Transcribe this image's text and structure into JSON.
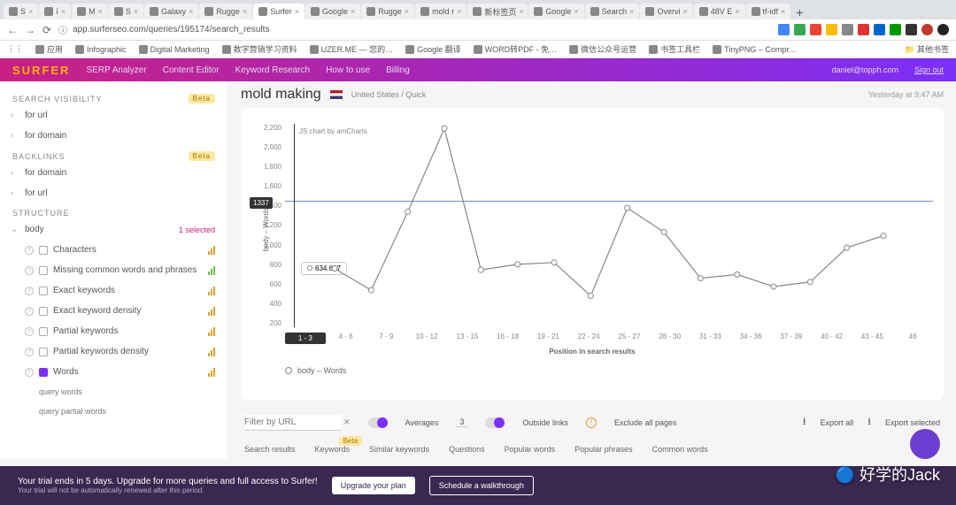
{
  "browser": {
    "tabs": [
      "S",
      "ⅰ",
      "M",
      "S",
      "Galaxy",
      "Rugge",
      "Surfer",
      "Google",
      "Rugge",
      "mold r",
      "新标签页",
      "Google",
      "Search",
      "Overvi",
      "48V E",
      "tf-idf"
    ],
    "active_tab_index": 6,
    "url": "app.surferseo.com/queries/195174/search_results",
    "bookmarks": [
      "应用",
      "Infographic",
      "Digital Marketing",
      "数字营销学习资料",
      "UZER.ME — 您的…",
      "Google 翻译",
      "WORD转PDF - 免…",
      "微信公众号运营",
      "书签工具栏",
      "TinyPNG – Compr…"
    ],
    "bookmarks_more": "其他书签"
  },
  "topbar": {
    "logo": "SURFER",
    "nav": [
      "SERP Analyzer",
      "Content Editor",
      "Keyword Research",
      "How to use",
      "Billing"
    ],
    "user_email": "daniel@topph.com",
    "signout": "Sign out"
  },
  "sidebar": {
    "sections": [
      {
        "title": "SEARCH VISIBILITY",
        "beta": "Beta",
        "items": [
          "for url",
          "for domain"
        ]
      },
      {
        "title": "BACKLINKS",
        "beta": "Beta",
        "items": [
          "for domain",
          "for url"
        ]
      },
      {
        "title": "STRUCTURE",
        "items": []
      }
    ],
    "body_label": "body",
    "body_selected": "1 selected",
    "structure_items": [
      {
        "label": "Characters",
        "checked": false,
        "color": "orange"
      },
      {
        "label": "Missing common words and phrases",
        "checked": false,
        "color": "green"
      },
      {
        "label": "Exact keywords",
        "checked": false,
        "color": "orange"
      },
      {
        "label": "Exact keyword density",
        "checked": false,
        "color": "orange"
      },
      {
        "label": "Partial keywords",
        "checked": false,
        "color": "orange"
      },
      {
        "label": "Partial keywords density",
        "checked": false,
        "color": "orange"
      },
      {
        "label": "Words",
        "checked": true,
        "color": "orange"
      }
    ],
    "sub_items": [
      "query words",
      "query partial words"
    ]
  },
  "page": {
    "title": "mold making",
    "location": "United States / Quick",
    "timestamp": "Yesterday at 9:47 AM"
  },
  "chart_data": {
    "type": "line",
    "title": "",
    "credit": "JS chart by amCharts",
    "xlabel": "Position in search results",
    "ylabel": "body – Words",
    "ylim": [
      0,
      2200
    ],
    "yticks": [
      2200,
      2000,
      1800,
      1600,
      1400,
      1200,
      1000,
      800,
      600,
      400,
      200
    ],
    "categories": [
      "1 - 3",
      "4 - 6",
      "7 - 9",
      "10 - 12",
      "13 - 15",
      "16 - 18",
      "19 - 21",
      "22 - 24",
      "25 - 27",
      "28 - 30",
      "31 - 33",
      "34 - 36",
      "37 - 39",
      "40 - 42",
      "43 - 45",
      "46"
    ],
    "series": [
      {
        "name": "body – Words",
        "values": [
          634.667,
          400,
          1250,
          2150,
          620,
          680,
          700,
          340,
          1290,
          1030,
          530,
          570,
          440,
          490,
          860,
          990
        ]
      }
    ],
    "reference_line": 1364,
    "guide_value": 1337,
    "hover_value": "634.667",
    "hover_category_index": 0
  },
  "filters": {
    "placeholder": "Filter by URL",
    "averages_label": "Averages",
    "averages_value": "3",
    "outside_label": "Outside links",
    "exclude_label": "Exclude all pages",
    "export_all": "Export all",
    "export_selected": "Export selected"
  },
  "result_tabs": [
    "Search results",
    "Keywords",
    "Similar keywords",
    "Questions",
    "Popular words",
    "Popular phrases",
    "Common words"
  ],
  "result_tabs_beta_index": 1,
  "trial": {
    "headline": "Your trial ends in 5 days. Upgrade for more queries and full access to Surfer!",
    "sub": "Your trial will not be automatically renewed after this period.",
    "btn1": "Upgrade your plan",
    "btn2": "Schedule a walkthrough"
  },
  "watermark": "好学的Jack"
}
